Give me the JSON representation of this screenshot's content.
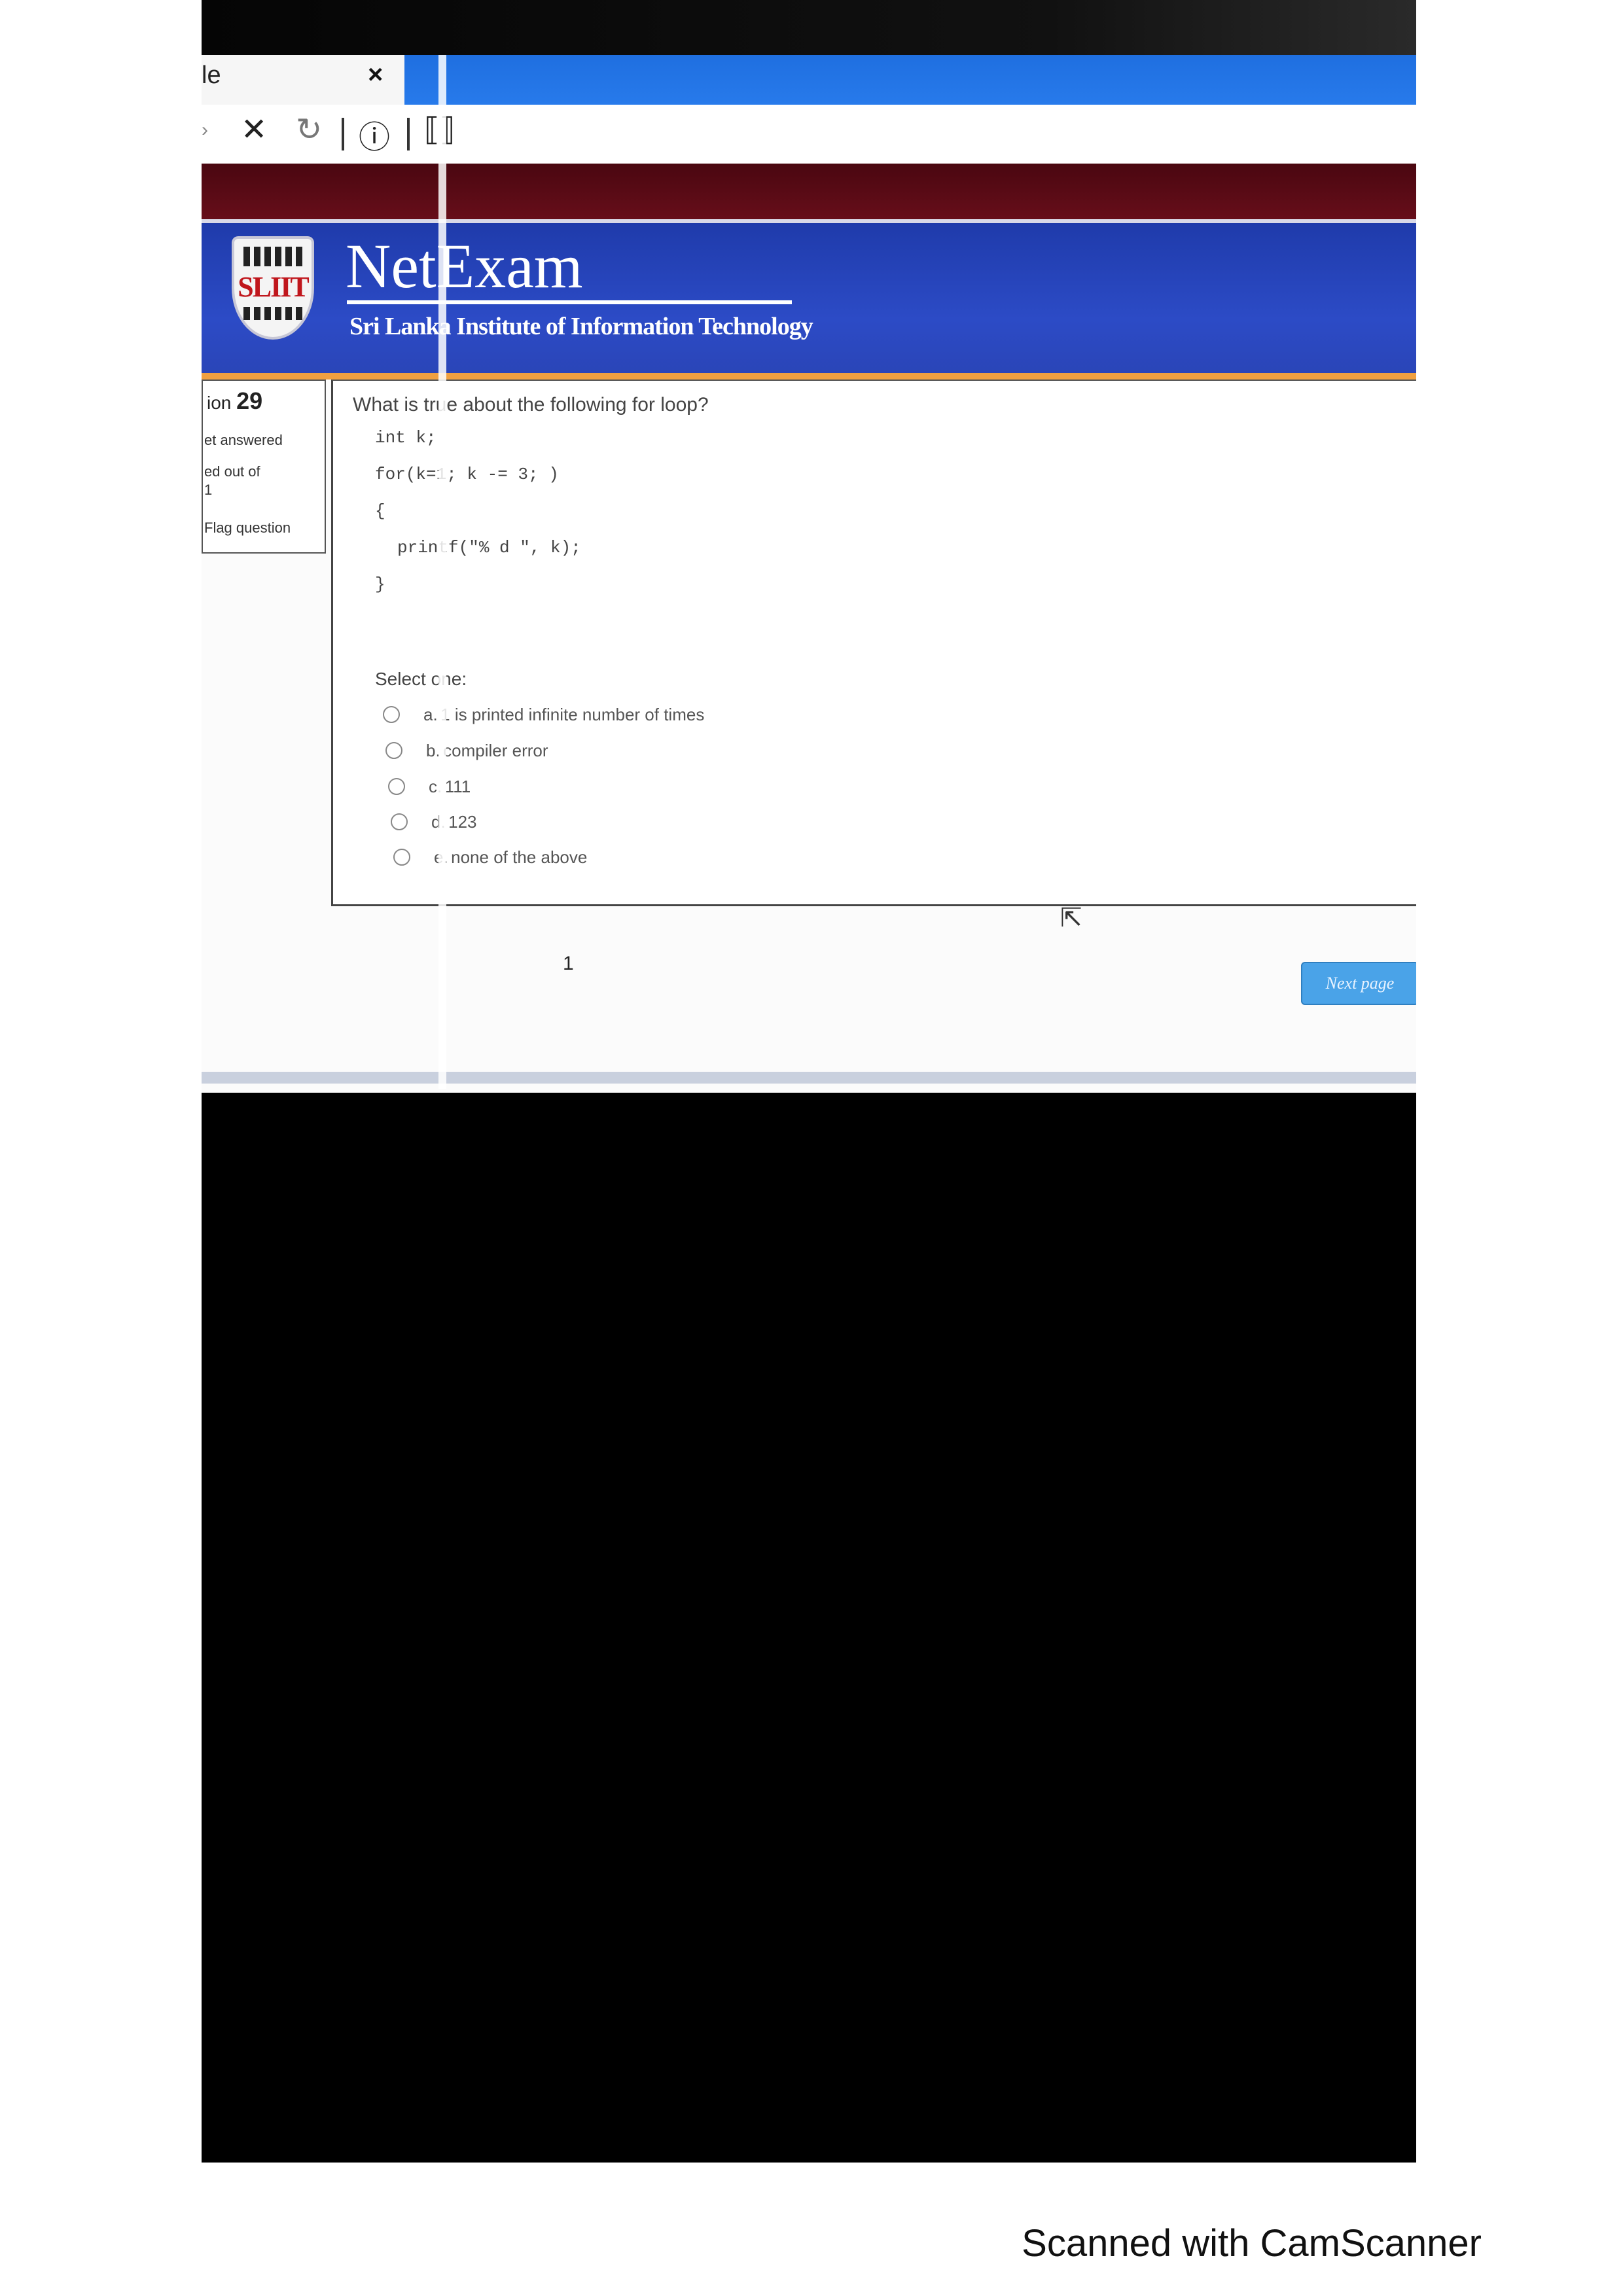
{
  "browser": {
    "tab_title": "le",
    "tab_close_glyph": "×",
    "nav_icons": [
      "forward-icon",
      "stop-icon",
      "reload-icon",
      "info-icon",
      "reader-icon"
    ]
  },
  "header": {
    "logo_text": "SLIIT",
    "brand": "NetExam",
    "subtitle": "Sri Lanka Institute of Information Technology"
  },
  "info": {
    "question_prefix": "ion",
    "question_number": "29",
    "status": "et answered",
    "marks": "ed out of",
    "marks_value": "1",
    "flag": "Flag question"
  },
  "question": {
    "text": "What is true about the following for loop?",
    "code": [
      "int k;",
      "for(k=1; k -= 3; )",
      "{",
      "printf(\"% d \", k);",
      "}"
    ],
    "select_label": "Select one:",
    "options": [
      {
        "letter": "a.",
        "text": "1 is printed infinite number of times"
      },
      {
        "letter": "b.",
        "text": "compiler error"
      },
      {
        "letter": "c.",
        "text": "111"
      },
      {
        "letter": "d.",
        "text": "123"
      },
      {
        "letter": "e.",
        "text": "none of the above"
      }
    ]
  },
  "nav": {
    "page_number": "1",
    "next_label": "Next page"
  },
  "footer": {
    "watermark": "Scanned with CamScanner"
  },
  "colors": {
    "header_blue": "#2c4bc6",
    "maroon": "#6c0f1c",
    "next_button": "#4aa3e8",
    "accent_orange": "#f0a040"
  }
}
